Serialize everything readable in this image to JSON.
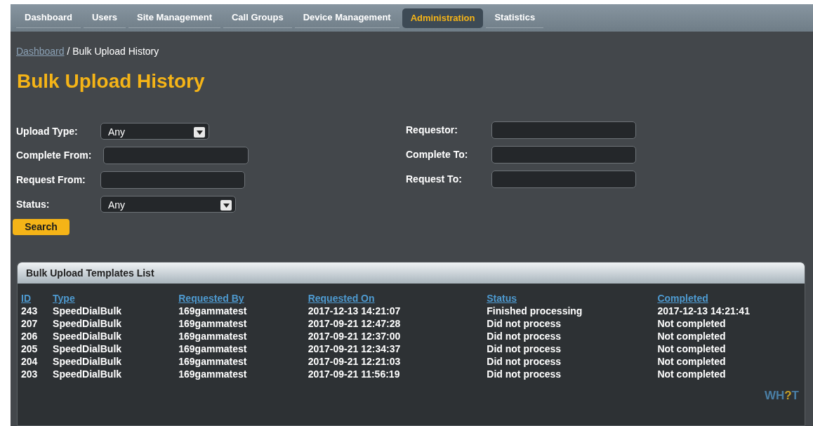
{
  "nav": {
    "tabs": [
      {
        "label": "Dashboard",
        "selected": false
      },
      {
        "label": "Users",
        "selected": false
      },
      {
        "label": "Site Management",
        "selected": false
      },
      {
        "label": "Call Groups",
        "selected": false
      },
      {
        "label": "Device Management",
        "selected": false
      },
      {
        "label": "Administration",
        "selected": true
      },
      {
        "label": "Statistics",
        "selected": false
      }
    ]
  },
  "breadcrumb": {
    "link": "Dashboard",
    "current": "/ Bulk Upload History"
  },
  "title": "Bulk Upload History",
  "filters": {
    "left": [
      {
        "label": "Upload Type:",
        "kind": "select",
        "value": "Any"
      },
      {
        "label": "Complete From:",
        "kind": "input"
      },
      {
        "label": "Request From:",
        "kind": "input"
      },
      {
        "label": "Status:",
        "kind": "select",
        "value": "Any"
      }
    ],
    "right": [
      {
        "label": "Requestor:",
        "kind": "input"
      },
      {
        "label": "Complete To:",
        "kind": "input"
      },
      {
        "label": "Request To:",
        "kind": "input"
      }
    ],
    "search_button": "Search"
  },
  "panel": {
    "title": "Bulk Upload Templates List",
    "table": {
      "columns": [
        "ID",
        "Type",
        "Requested By",
        "Requested On",
        "Status",
        "Completed"
      ],
      "rows": [
        [
          "243",
          "SpeedDialBulk",
          "169gammatest",
          "2017-12-13 14:21:07",
          "Finished processing",
          "2017-12-13 14:21:41"
        ],
        [
          "207",
          "SpeedDialBulk",
          "169gammatest",
          "2017-09-21 12:47:28",
          "Did not process",
          "Not completed"
        ],
        [
          "206",
          "SpeedDialBulk",
          "169gammatest",
          "2017-09-21 12:37:00",
          "Did not process",
          "Not completed"
        ],
        [
          "205",
          "SpeedDialBulk",
          "169gammatest",
          "2017-09-21 12:34:37",
          "Did not process",
          "Not completed"
        ],
        [
          "204",
          "SpeedDialBulk",
          "169gammatest",
          "2017-09-21 12:21:03",
          "Did not process",
          "Not completed"
        ],
        [
          "203",
          "SpeedDialBulk",
          "169gammatest",
          "2017-09-21 11:56:19",
          "Did not process",
          "Not completed"
        ]
      ]
    },
    "logo": [
      {
        "text": "WH",
        "accent": false
      },
      {
        "text": "?",
        "accent": true
      },
      {
        "text": "T",
        "accent": false
      }
    ]
  }
}
